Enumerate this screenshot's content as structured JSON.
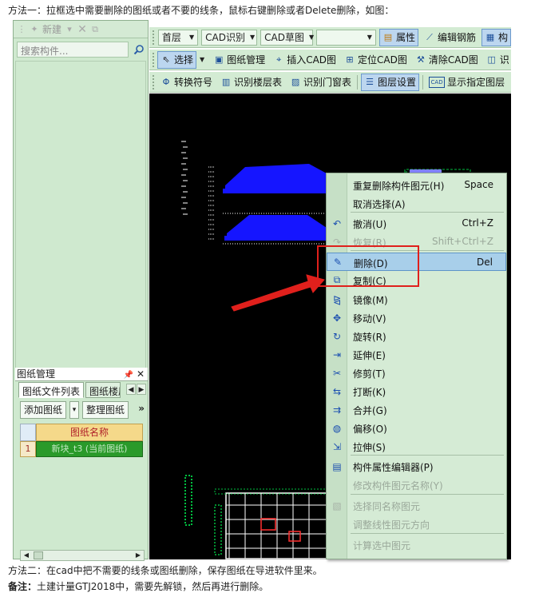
{
  "doc": {
    "line1": "方法一：拉框选中需要删除的图纸或者不要的线条，鼠标右键删除或者Delete删除，如图：",
    "line2": "方法二：在cad中把不需要的线条或图纸删除，保存图纸在导进软件里来。",
    "line3_bold": "备注：",
    "line3_rest": "土建计量GTJ2018中，需要先解锁，然后再进行删除。"
  },
  "left_panel": {
    "new_label": "新建",
    "search_placeholder": "搜索构件...",
    "drawing_panel": {
      "title": "图纸管理",
      "tabs": [
        "图纸文件列表",
        "图纸楼层"
      ],
      "add_button": "添加图纸",
      "organize_button": "整理图纸",
      "more": "»",
      "column_header": "图纸名称",
      "rows": [
        {
          "num": "1",
          "name": "新块_t3 (当前图纸)"
        }
      ]
    }
  },
  "toolbar1": {
    "floor": "首层",
    "cad_identify": "CAD识别",
    "cad_sketch": "CAD草图",
    "empty_combo": "",
    "properties": "属性",
    "edit_rebar": "编辑钢筋",
    "component": "构"
  },
  "toolbar2": {
    "select": "选择",
    "drawing_manage": "图纸管理",
    "insert_cad": "插入CAD图",
    "locate_cad": "定位CAD图",
    "clear_cad": "清除CAD图",
    "identify_short": "识"
  },
  "toolbar3": {
    "convert_symbol": "转换符号",
    "identify_floor_table": "识别楼层表",
    "identify_door_window": "识别门窗表",
    "layer_settings": "图层设置",
    "show_layer": "显示指定图层"
  },
  "context_menu": {
    "items": [
      {
        "label": "重复删除构件图元(H)",
        "shortcut": "Space",
        "icon": "none",
        "disabled": false
      },
      {
        "label": "取消选择(A)",
        "shortcut": "",
        "icon": "none",
        "disabled": false
      },
      {
        "label": "撤消(U)",
        "shortcut": "Ctrl+Z",
        "icon": "undo-icon",
        "disabled": false
      },
      {
        "label": "恢复(R)",
        "shortcut": "Shift+Ctrl+Z",
        "icon": "redo-icon",
        "disabled": true
      },
      {
        "label": "删除(D)",
        "shortcut": "Del",
        "icon": "eraser-icon",
        "disabled": false
      },
      {
        "label": "复制(C)",
        "shortcut": "",
        "icon": "copy-icon",
        "disabled": false
      },
      {
        "label": "镜像(M)",
        "shortcut": "",
        "icon": "mirror-icon",
        "disabled": false
      },
      {
        "label": "移动(V)",
        "shortcut": "",
        "icon": "move-icon",
        "disabled": false
      },
      {
        "label": "旋转(R)",
        "shortcut": "",
        "icon": "rotate-icon",
        "disabled": false
      },
      {
        "label": "延伸(E)",
        "shortcut": "",
        "icon": "extend-icon",
        "disabled": false
      },
      {
        "label": "修剪(T)",
        "shortcut": "",
        "icon": "trim-icon",
        "disabled": false
      },
      {
        "label": "打断(K)",
        "shortcut": "",
        "icon": "break-icon",
        "disabled": false
      },
      {
        "label": "合并(G)",
        "shortcut": "",
        "icon": "merge-icon",
        "disabled": false
      },
      {
        "label": "偏移(O)",
        "shortcut": "",
        "icon": "offset-icon",
        "disabled": false
      },
      {
        "label": "拉伸(S)",
        "shortcut": "",
        "icon": "stretch-icon",
        "disabled": false
      },
      {
        "label": "构件属性编辑器(P)",
        "shortcut": "",
        "icon": "property-editor-icon",
        "disabled": false
      },
      {
        "label": "修改构件图元名称(Y)",
        "shortcut": "",
        "icon": "none",
        "disabled": true
      },
      {
        "label": "选择同名称图元",
        "shortcut": "",
        "icon": "select-same-icon",
        "disabled": true
      },
      {
        "label": "调整线性图元方向",
        "shortcut": "",
        "icon": "none",
        "disabled": true
      },
      {
        "label": "计算选中图元",
        "shortcut": "",
        "icon": "none",
        "disabled": true
      }
    ]
  },
  "colors": {
    "panel_green": "#cfe9cf",
    "canvas": "#000000",
    "annotation_red": "#e0201c",
    "cad_blue": "#1515ff",
    "cad_green": "#00c040",
    "cad_white": "#ffffff"
  }
}
